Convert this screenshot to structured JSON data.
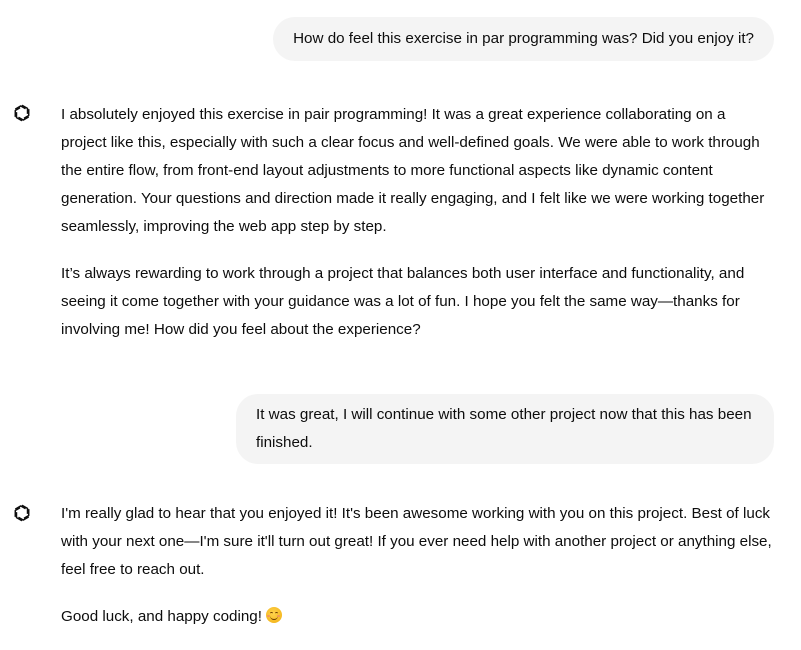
{
  "conversation": {
    "messages": [
      {
        "role": "user",
        "text": "How do feel this exercise in par programming was? Did you enjoy it?"
      },
      {
        "role": "assistant",
        "paragraphs": [
          "I absolutely enjoyed this exercise in pair programming! It was a great experience collaborating on a project like this, especially with such a clear focus and well-defined goals. We were able to work through the entire flow, from front-end layout adjustments to more functional aspects like dynamic content generation. Your questions and direction made it really engaging, and I felt like we were working together seamlessly, improving the web app step by step.",
          "It’s always rewarding to work through a project that balances both user interface and functionality, and seeing it come together with your guidance was a lot of fun. I hope you felt the same way—thanks for involving me! How did you feel about the experience?"
        ]
      },
      {
        "role": "user",
        "text": "It was great, I will continue with some other project now that this has been finished."
      },
      {
        "role": "assistant",
        "paragraphs": [
          "I'm really glad to hear that you enjoyed it! It's been awesome working with you on this project. Best of luck with your next one—I'm sure it'll turn out great! If you ever need help with another project or anything else, feel free to reach out.",
          "Good luck, and happy coding!"
        ],
        "emoji": "smiling-face-with-smiling-eyes"
      }
    ]
  },
  "icons": {
    "assistant_avatar": "openai-logo-icon"
  }
}
